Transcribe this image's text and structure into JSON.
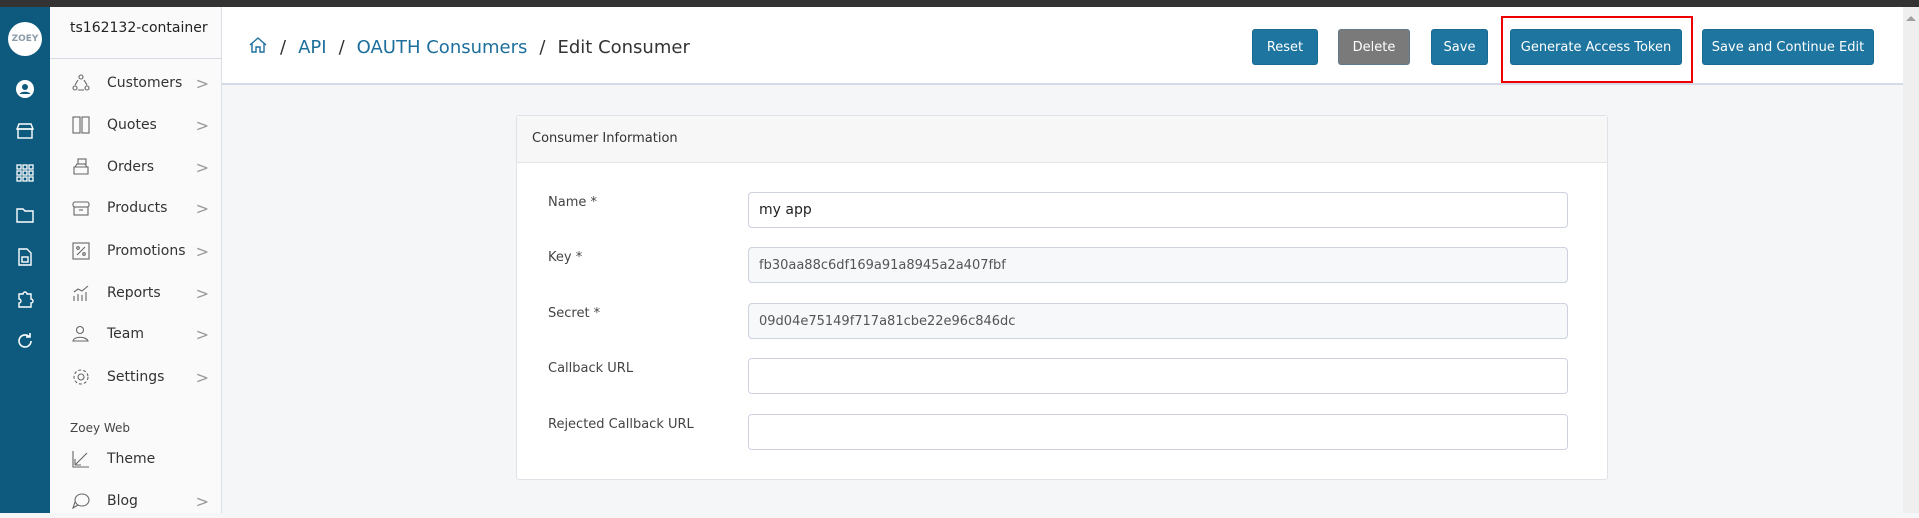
{
  "rail": {
    "logo": "ZOEY",
    "icons": [
      "account-icon",
      "store-icon",
      "apps-grid-icon",
      "folder-icon",
      "spreadsheet-icon",
      "puzzle-icon",
      "refresh-icon"
    ]
  },
  "sidebar": {
    "store_name": "ts162132-container",
    "items": [
      {
        "label": "Customers"
      },
      {
        "label": "Quotes"
      },
      {
        "label": "Orders"
      },
      {
        "label": "Products"
      },
      {
        "label": "Promotions"
      },
      {
        "label": "Reports"
      },
      {
        "label": "Team"
      },
      {
        "label": "Settings"
      }
    ],
    "section_title": "Zoey Web",
    "web_items": [
      {
        "label": "Theme"
      },
      {
        "label": "Blog"
      }
    ]
  },
  "breadcrumb": {
    "items": [
      "API",
      "OAUTH Consumers"
    ],
    "current": "Edit Consumer",
    "separator": "/"
  },
  "toolbar": {
    "reset": "Reset",
    "delete": "Delete",
    "save": "Save",
    "generate": "Generate Access Token",
    "save_continue": "Save and Continue Edit"
  },
  "panel": {
    "title": "Consumer Information",
    "fields": [
      {
        "label": "Name *",
        "value": "my app"
      },
      {
        "label": "Key *",
        "value": "fb30aa88c6df169a91a8945a2a407fbf"
      },
      {
        "label": "Secret *",
        "value": "09d04e75149f717a81cbe22e96c846dc"
      },
      {
        "label": "Callback URL",
        "value": ""
      },
      {
        "label": "Rejected Callback URL",
        "value": ""
      }
    ]
  },
  "colors": {
    "rail": "#0e5a7e",
    "primary": "#1d75a0",
    "delete": "#7a7a7a",
    "highlight": "#e00000"
  }
}
